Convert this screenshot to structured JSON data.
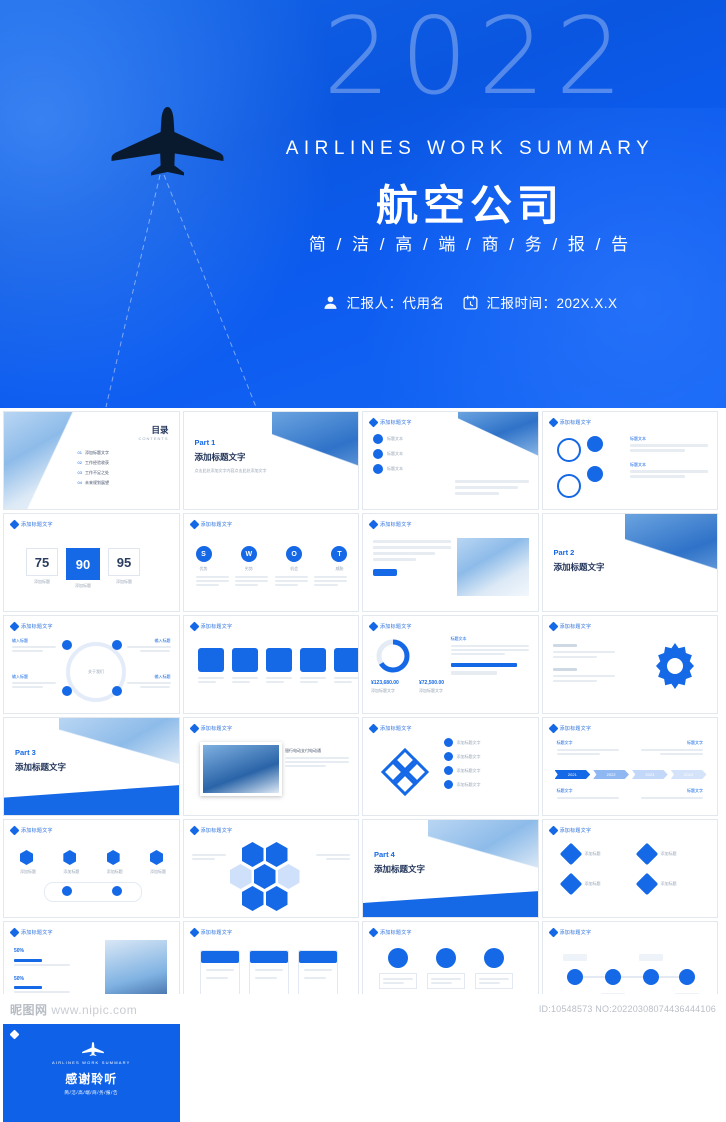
{
  "hero": {
    "year": "2022",
    "english_title": "AIRLINES  WORK  SUMMARY",
    "chinese_title": "航空公司",
    "subtitle": "简 / 洁 / 高 / 端 / 商 / 务 / 报 / 告",
    "presenter_label": "汇报人：代用名",
    "date_label": "汇报时间：202X.X.X",
    "presenter_icon": "user-icon",
    "date_icon": "calendar-icon",
    "plane_icon": "airplane-icon",
    "colors": {
      "bg_start": "#1464e6",
      "bg_end": "#1466f5",
      "text": "#ffffff"
    }
  },
  "common": {
    "tag_label": "添加标题文字",
    "placeholder_title": "添加标题文字",
    "placeholder_body": "输入标题",
    "lorem": "点击此处添加文字内容点击此处添加文字内容"
  },
  "slides": [
    {
      "id": 1,
      "kind": "contents",
      "title": "目录",
      "title_en": "CONTENTS",
      "items": [
        {
          "no": "01",
          "label": "添加标题文字"
        },
        {
          "no": "02",
          "label": "工作经验收获"
        },
        {
          "no": "03",
          "label": "工作不足之处"
        },
        {
          "no": "04",
          "label": "未来规划展望"
        }
      ]
    },
    {
      "id": 2,
      "kind": "part",
      "part": "Part 1",
      "title": "添加标题文字",
      "desc": "点击此处添加文字内容点击此处添加文字"
    },
    {
      "id": 3,
      "kind": "cards-right",
      "tag": "添加标题文字",
      "cards": [
        "标题文本",
        "标题文本",
        "标题文本"
      ],
      "body": "点击此处添加文字内容"
    },
    {
      "id": 4,
      "kind": "circles-text",
      "tag": "添加标题文字",
      "labels": [
        "标题文本",
        "标题文本"
      ]
    },
    {
      "id": 5,
      "kind": "kpi",
      "tag": "添加标题文字",
      "values": [
        "75",
        "90",
        "95"
      ],
      "captions": [
        "添加标题",
        "添加标题",
        "添加标题"
      ]
    },
    {
      "id": 6,
      "kind": "swot",
      "tag": "添加标题文字",
      "letters": [
        "S",
        "W",
        "O",
        "T"
      ],
      "labels": [
        "优势",
        "劣势",
        "机会",
        "威胁"
      ]
    },
    {
      "id": 7,
      "kind": "text-photo",
      "tag": "添加标题文字",
      "body": "点击此处添加文字内容点击此处添加文字内容"
    },
    {
      "id": 8,
      "kind": "part-photo",
      "part": "Part 2",
      "title": "添加标题文字"
    },
    {
      "id": 9,
      "kind": "ring-icons",
      "tag": "添加标题文字",
      "center": "关于我们",
      "labels": [
        "输入标题",
        "输入标题",
        "输入标题",
        "输入标题"
      ]
    },
    {
      "id": 10,
      "kind": "icon-row",
      "tag": "添加标题文字",
      "count": 4
    },
    {
      "id": 11,
      "kind": "donut-stats",
      "tag": "添加标题文字",
      "stats": [
        "¥123,680.00",
        "¥72,500.00"
      ],
      "captions": [
        "添加标题文字",
        "添加标题文字"
      ]
    },
    {
      "id": 12,
      "kind": "gear",
      "tag": "添加标题文字",
      "icon": "gear-icon"
    },
    {
      "id": 13,
      "kind": "part-photo",
      "part": "Part 3",
      "title": "添加标题文字"
    },
    {
      "id": 14,
      "kind": "photo-card",
      "tag": "添加标题文字",
      "caption": "银行电动支付电动通"
    },
    {
      "id": 15,
      "kind": "flower-list",
      "tag": "添加标题文字",
      "labels": [
        "添加标题文字",
        "添加标题文字",
        "添加标题文字",
        "添加标题文字"
      ]
    },
    {
      "id": 16,
      "kind": "timeline",
      "tag": "添加标题文字",
      "years": [
        "2021",
        "2022",
        "2023",
        "2024"
      ],
      "labels": [
        "标题文字",
        "标题文字"
      ]
    },
    {
      "id": 17,
      "kind": "hex-row",
      "tag": "添加标题文字",
      "labels": [
        "添加标题",
        "添加标题",
        "添加标题",
        "添加标题"
      ]
    },
    {
      "id": 18,
      "kind": "hex-cluster",
      "tag": "添加标题文字"
    },
    {
      "id": 19,
      "kind": "part-photo",
      "part": "Part 4",
      "title": "添加标题文字"
    },
    {
      "id": 20,
      "kind": "diamond-grid",
      "tag": "添加标题文字",
      "labels": [
        "添加标题",
        "添加标题",
        "添加标题",
        "添加标题"
      ]
    },
    {
      "id": 21,
      "kind": "percent-photo",
      "tag": "添加标题文字",
      "percents": [
        "50%",
        "50%"
      ]
    },
    {
      "id": 22,
      "kind": "cards-3",
      "tag": "添加标题文字",
      "count": 3
    },
    {
      "id": 23,
      "kind": "person-cards",
      "tag": "添加标题文字",
      "count": 3
    },
    {
      "id": 24,
      "kind": "flow",
      "tag": "添加标题文字"
    },
    {
      "id": 25,
      "kind": "thanks",
      "title": "感谢聆听",
      "english": "AIRLINES  WORK  SUMMARY",
      "subtitle": "简/洁/高/端/商/务/报/告"
    }
  ],
  "footer": {
    "watermark_main": "昵图网",
    "watermark_url": "www.nipic.com",
    "id_text": "ID:10548573  NO:20220308074436444106"
  }
}
